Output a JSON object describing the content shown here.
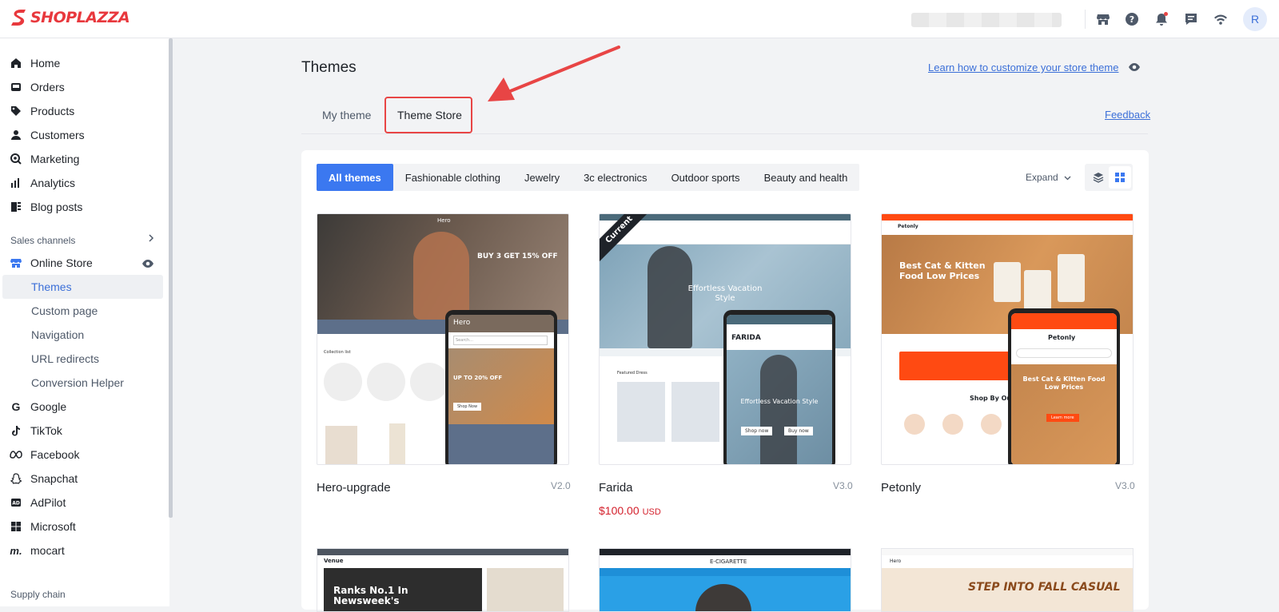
{
  "brand": {
    "name": "SHOPLAZZA",
    "color": "#e8383d"
  },
  "topbar": {
    "icons": [
      "store-icon",
      "help-icon",
      "bell-icon",
      "chat-icon",
      "wifi-icon"
    ],
    "avatar_initial": "R"
  },
  "sidebar": {
    "items": [
      {
        "label": "Home",
        "icon": "home-icon"
      },
      {
        "label": "Orders",
        "icon": "orders-icon"
      },
      {
        "label": "Products",
        "icon": "tag-icon"
      },
      {
        "label": "Customers",
        "icon": "person-icon"
      },
      {
        "label": "Marketing",
        "icon": "marketing-icon"
      },
      {
        "label": "Analytics",
        "icon": "analytics-icon"
      },
      {
        "label": "Blog posts",
        "icon": "blog-icon"
      }
    ],
    "sales_channels_label": "Sales channels",
    "online_store_label": "Online Store",
    "sub_items": [
      "Themes",
      "Custom page",
      "Navigation",
      "URL redirects",
      "Conversion Helper"
    ],
    "channels": [
      {
        "label": "Google",
        "icon": "google-icon"
      },
      {
        "label": "TikTok",
        "icon": "tiktok-icon"
      },
      {
        "label": "Facebook",
        "icon": "meta-icon"
      },
      {
        "label": "Snapchat",
        "icon": "snapchat-icon"
      },
      {
        "label": "AdPilot",
        "icon": "adpilot-icon"
      },
      {
        "label": "Microsoft",
        "icon": "microsoft-icon"
      },
      {
        "label": "mocart",
        "icon": "mocart-icon"
      }
    ],
    "supply_chain_label": "Supply chain"
  },
  "main": {
    "title": "Themes",
    "learn_link": "Learn how to customize your store theme",
    "tabs": [
      "My theme",
      "Theme Store"
    ],
    "feedback": "Feedback",
    "filters": [
      "All themes",
      "Fashionable clothing",
      "Jewelry",
      "3c electronics",
      "Outdoor sports",
      "Beauty and health"
    ],
    "expand": "Expand",
    "themes": [
      {
        "name": "Hero-upgrade",
        "version": "V2.0",
        "preview": {
          "brand": "Hero",
          "promo": "BUY 3 GET 15% OFF",
          "mobile_promo": "UP TO 20% OFF",
          "section": "Collection list",
          "search": "Search...",
          "button": "Shop Now"
        }
      },
      {
        "name": "Farida",
        "version": "V3.0",
        "price": "$100.00",
        "currency": "USD",
        "badge": "Current",
        "preview": {
          "brand": "FARIDA",
          "headline": "Effortless Vacation Style",
          "mobile_headline": "Effortless Vacation Style",
          "section": "Featured Dress",
          "btn1": "Shop now",
          "btn2": "Buy now"
        }
      },
      {
        "name": "Petonly",
        "version": "V3.0",
        "preview": {
          "brand": "Petonly",
          "headline": "Best Cat & Kitten Food Low Prices",
          "mobile_headline": "Best Cat & Kitten Food Low Prices",
          "section": "Shop By Ou",
          "button": "Learn more"
        }
      }
    ],
    "row2": [
      {
        "brand": "Venue",
        "headline": "Ranks No.1 In Newsweek's"
      },
      {
        "brand": "E-CIGARETTE"
      },
      {
        "brand": "Hero",
        "headline": "STEP INTO FALL CASUAL"
      }
    ]
  }
}
